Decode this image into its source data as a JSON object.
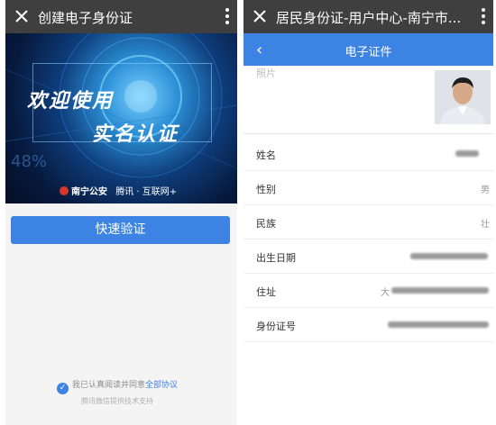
{
  "left": {
    "header": {
      "title": "创建电子身份证",
      "close_icon": "close-icon",
      "more_icon": "more-vertical-icon"
    },
    "banner": {
      "line1": "欢迎使用",
      "line2": "实名认证",
      "bg_text": "48%",
      "brands": [
        "南宁公安",
        "腾讯 · 互联网+"
      ]
    },
    "verify_button": "快速验证",
    "agreement": {
      "prefix": "我已认真阅读并同意",
      "link": "全部协议"
    },
    "support": "腾讯微信提供技术支持"
  },
  "right": {
    "header": {
      "title": "居民身份证-用户中心-南宁市...",
      "close_icon": "close-icon",
      "more_icon": "more-vertical-icon"
    },
    "subheader": {
      "title": "电子证件",
      "back_icon": "chevron-left-icon"
    },
    "photo_label": "照片",
    "fields": [
      {
        "label": "姓名",
        "value": ""
      },
      {
        "label": "性别",
        "value": "男"
      },
      {
        "label": "民族",
        "value": "壮"
      },
      {
        "label": "出生日期",
        "value": ""
      },
      {
        "label": "住址",
        "value": "大"
      },
      {
        "label": "身份证号",
        "value": ""
      }
    ]
  },
  "colors": {
    "accent": "#3c83e4",
    "topbar": "#3f3f3f",
    "banner_dark": "#071a3e"
  }
}
